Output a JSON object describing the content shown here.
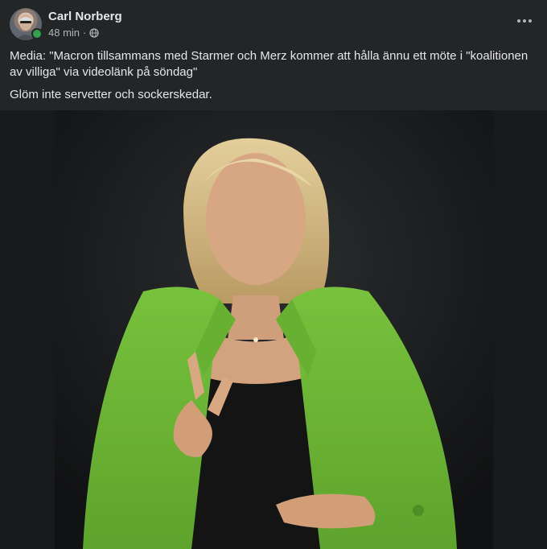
{
  "post": {
    "author": "Carl Norberg",
    "time": "48 min",
    "separator": "·",
    "privacy_icon": "globe-icon",
    "more_icon": "more-options-icon",
    "text_lines": [
      "Media: \"Macron tillsammans med Starmer och Merz kommer att hålla ännu ett möte i \"koalitionen av villiga\" via videolänk på söndag\"",
      "Glöm inte servetter och sockerskedar."
    ]
  },
  "colors": {
    "background": "#242526",
    "text_primary": "#e4e6eb",
    "text_secondary": "#b0b3b8",
    "online": "#31a24c",
    "jacket": "#6cb336"
  }
}
